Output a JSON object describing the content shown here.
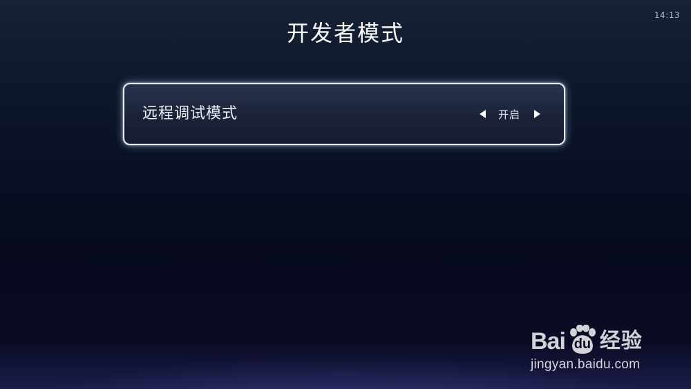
{
  "status_bar": {
    "clock": "14:13"
  },
  "header": {
    "title": "开发者模式"
  },
  "settings": {
    "items": [
      {
        "label": "远程调试模式",
        "value": "开启",
        "focused": true
      }
    ]
  },
  "watermark": {
    "brand_bai": "Bai",
    "brand_du": "du",
    "brand_jingyan": "经验",
    "url": "jingyan.baidu.com"
  },
  "icons": {
    "prev": "caret-left-icon",
    "next": "caret-right-icon",
    "paw": "baidu-paw-icon"
  },
  "colors": {
    "background_top": "#162238",
    "background_bottom": "#1b1c48",
    "focus_border": "#e8eef6",
    "text": "#ffffff"
  }
}
